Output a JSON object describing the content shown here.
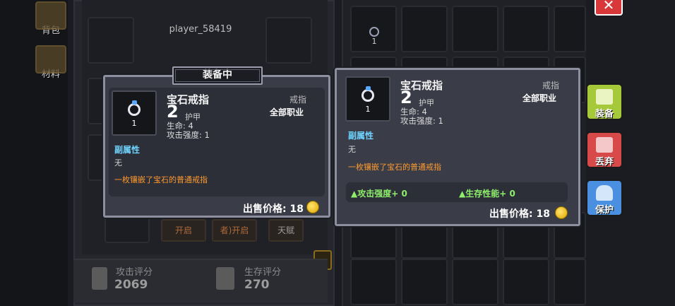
{
  "side_tabs": [
    {
      "label": "背包",
      "icon": "backpack-icon"
    },
    {
      "label": "材料",
      "icon": "materials-icon"
    }
  ],
  "character": {
    "player_name": "player_58419",
    "locked_slots": [
      "开启",
      "者)开启",
      "天赋"
    ],
    "scores": [
      {
        "label": "攻击评分",
        "value": "2069",
        "icon": "sword-icon"
      },
      {
        "label": "生存评分",
        "value": "270",
        "icon": "shield-icon"
      }
    ]
  },
  "bag": {
    "first_item_count": "1"
  },
  "tooltip_equipped": {
    "tag": "装备中",
    "name": "宝石戒指",
    "category": "戒指",
    "level": "2",
    "armor_label": "护甲",
    "class": "全部职业",
    "stats": [
      "生命:  4",
      "攻击强度:  1"
    ],
    "count": "1",
    "sub_attr_title": "副属性",
    "sub_attr_value": "无",
    "description": "一枚镶嵌了宝石的普通戒指",
    "price_label": "出售价格: 18"
  },
  "tooltip_bag": {
    "name": "宝石戒指",
    "category": "戒指",
    "level": "2",
    "armor_label": "护甲",
    "class": "全部职业",
    "stats": [
      "生命:  4",
      "攻击强度:  1"
    ],
    "count": "1",
    "sub_attr_title": "副属性",
    "sub_attr_value": "无",
    "description": "一枚镶嵌了宝石的普通戒指",
    "compare": [
      "▲攻击强度+ 0",
      "▲生存性能+ 0"
    ],
    "price_label": "出售价格: 18"
  },
  "actions": [
    {
      "label": "装备",
      "icon": "armor-icon",
      "color": "#a6c93a"
    },
    {
      "label": "丢弃",
      "icon": "trash-icon",
      "color": "#d84a4a"
    },
    {
      "label": "保护",
      "icon": "lock-icon",
      "color": "#4a8fe0"
    }
  ],
  "close_label": "✕",
  "colors": {
    "accent_orange": "#ff9b2f",
    "sub_attr_blue": "#6fd4ff",
    "compare_green": "#8ef06a"
  }
}
